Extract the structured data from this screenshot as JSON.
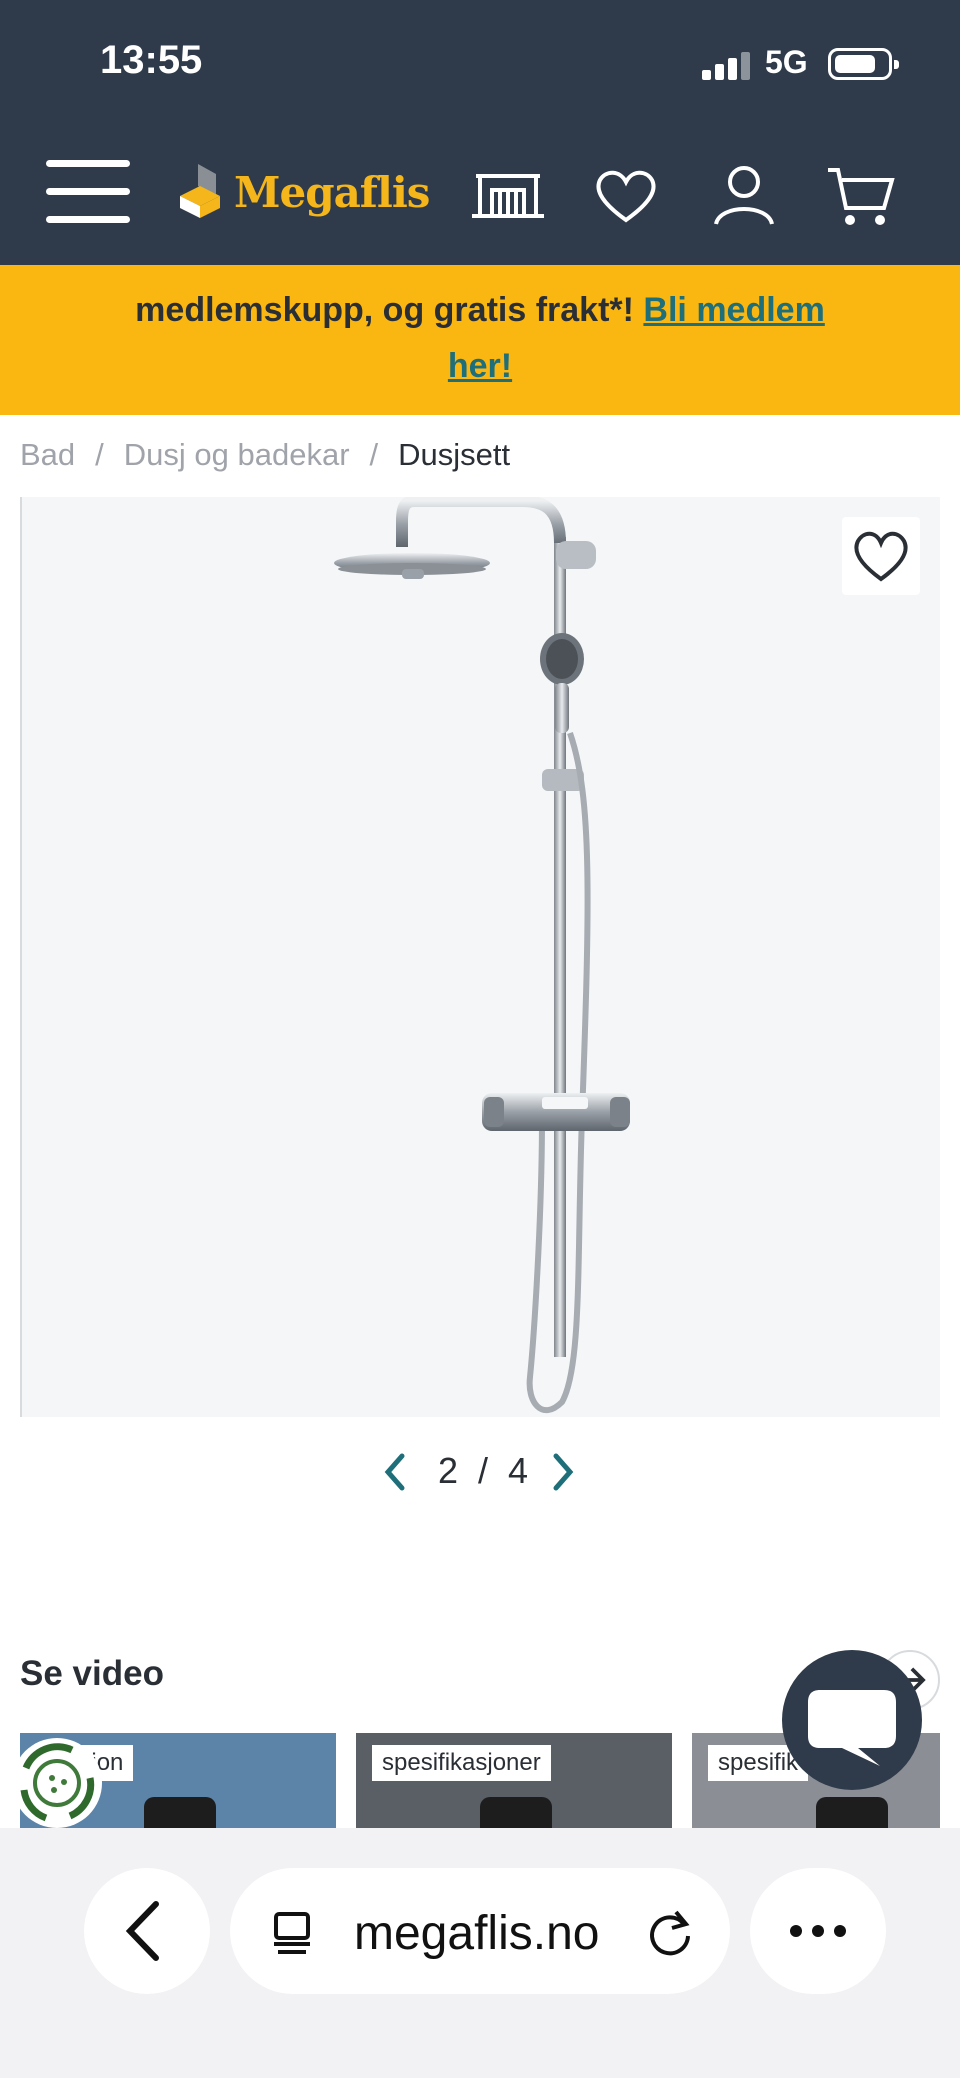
{
  "status": {
    "time": "13:55",
    "network": "5G"
  },
  "header": {
    "logo_text": "Megaflis"
  },
  "promo": {
    "line1_bold": "medlemskupp, og gratis frakt",
    "line1_tail": "*!",
    "link_part1": "Bli medlem",
    "link_part2": "her!"
  },
  "breadcrumb": {
    "items": [
      "Bad",
      "Dusj og badekar",
      "Dusjsett"
    ],
    "separator": "/"
  },
  "gallery": {
    "current": "2",
    "separator": "/",
    "total": "4"
  },
  "video_section": {
    "title": "Se video",
    "cards": [
      {
        "tag": "ntasjon"
      },
      {
        "tag": "spesifikasjoner"
      },
      {
        "tag": "spesifik"
      }
    ]
  },
  "browser": {
    "url": "megaflis.no"
  },
  "colors": {
    "header_bg": "#2f3b4a",
    "promo_bg": "#fbb711",
    "link": "#1f6f7a",
    "logo": "#f4b61a"
  }
}
